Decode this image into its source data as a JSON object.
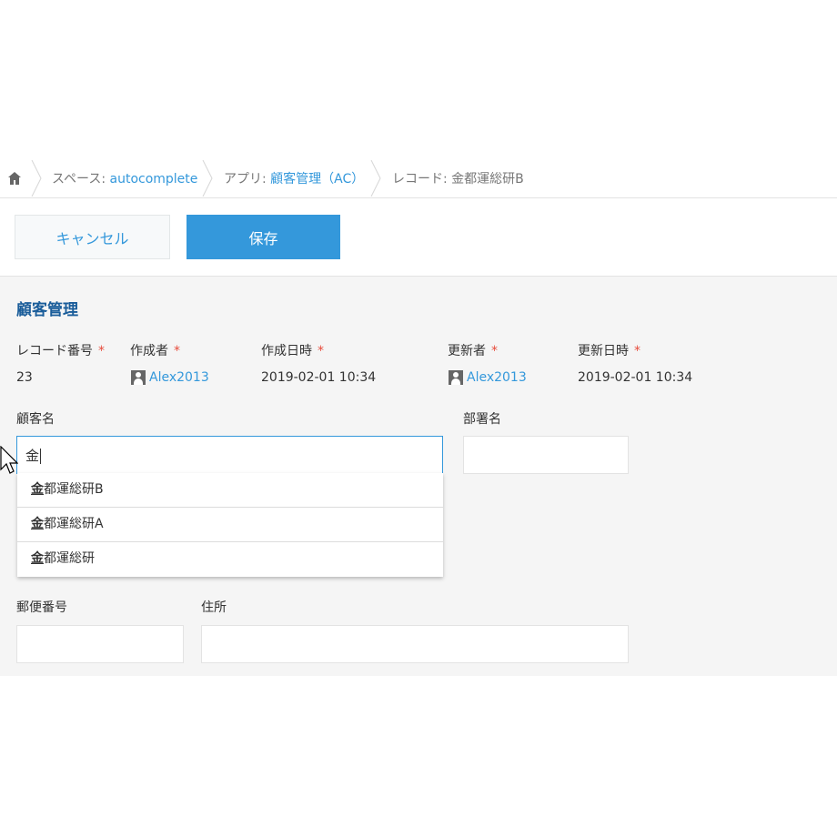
{
  "breadcrumb": {
    "home_icon": "home-icon",
    "space_prefix": "スペース: ",
    "space_name": "autocomplete",
    "app_prefix": "アプリ: ",
    "app_name": "顧客管理（AC）",
    "record_label": "レコード: 金都運総研B"
  },
  "toolbar": {
    "cancel_label": "キャンセル",
    "save_label": "保存"
  },
  "form": {
    "title": "顧客管理",
    "required_mark": "*",
    "record_number_label": "レコード番号",
    "record_number_value": "23",
    "created_by_label": "作成者",
    "created_by_value": "Alex2013",
    "created_at_label": "作成日時",
    "created_at_value": "2019-02-01 10:34",
    "updated_by_label": "更新者",
    "updated_by_value": "Alex2013",
    "updated_at_label": "更新日時",
    "updated_at_value": "2019-02-01 10:34",
    "customer_name_label": "顧客名",
    "customer_name_value": "金",
    "department_label": "部署名",
    "department_value": "",
    "postal_code_label": "郵便番号",
    "postal_code_value": "",
    "address_label": "住所",
    "address_value": ""
  },
  "autocomplete": {
    "items": [
      {
        "match": "金",
        "rest": "都運総研B"
      },
      {
        "match": "金",
        "rest": "都運総研A"
      },
      {
        "match": "金",
        "rest": "都運総研"
      }
    ]
  },
  "colors": {
    "accent": "#3498db",
    "title": "#1a5d9a",
    "required": "#e74c3c"
  }
}
